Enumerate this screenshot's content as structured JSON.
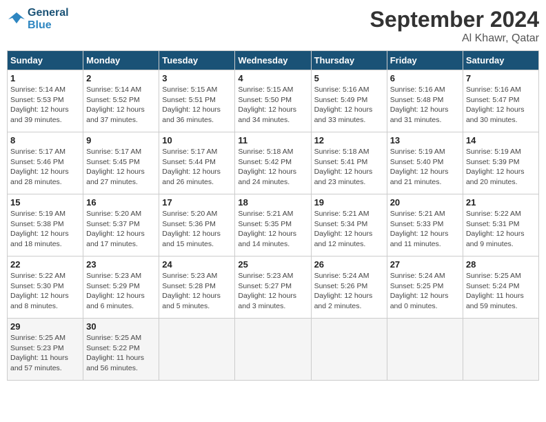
{
  "header": {
    "logo_line1": "General",
    "logo_line2": "Blue",
    "month": "September 2024",
    "location": "Al Khawr, Qatar"
  },
  "days_of_week": [
    "Sunday",
    "Monday",
    "Tuesday",
    "Wednesday",
    "Thursday",
    "Friday",
    "Saturday"
  ],
  "weeks": [
    [
      {
        "day": "1",
        "sunrise": "5:14 AM",
        "sunset": "5:53 PM",
        "daylight": "12 hours and 39 minutes."
      },
      {
        "day": "2",
        "sunrise": "5:14 AM",
        "sunset": "5:52 PM",
        "daylight": "12 hours and 37 minutes."
      },
      {
        "day": "3",
        "sunrise": "5:15 AM",
        "sunset": "5:51 PM",
        "daylight": "12 hours and 36 minutes."
      },
      {
        "day": "4",
        "sunrise": "5:15 AM",
        "sunset": "5:50 PM",
        "daylight": "12 hours and 34 minutes."
      },
      {
        "day": "5",
        "sunrise": "5:16 AM",
        "sunset": "5:49 PM",
        "daylight": "12 hours and 33 minutes."
      },
      {
        "day": "6",
        "sunrise": "5:16 AM",
        "sunset": "5:48 PM",
        "daylight": "12 hours and 31 minutes."
      },
      {
        "day": "7",
        "sunrise": "5:16 AM",
        "sunset": "5:47 PM",
        "daylight": "12 hours and 30 minutes."
      }
    ],
    [
      {
        "day": "8",
        "sunrise": "5:17 AM",
        "sunset": "5:46 PM",
        "daylight": "12 hours and 28 minutes."
      },
      {
        "day": "9",
        "sunrise": "5:17 AM",
        "sunset": "5:45 PM",
        "daylight": "12 hours and 27 minutes."
      },
      {
        "day": "10",
        "sunrise": "5:17 AM",
        "sunset": "5:44 PM",
        "daylight": "12 hours and 26 minutes."
      },
      {
        "day": "11",
        "sunrise": "5:18 AM",
        "sunset": "5:42 PM",
        "daylight": "12 hours and 24 minutes."
      },
      {
        "day": "12",
        "sunrise": "5:18 AM",
        "sunset": "5:41 PM",
        "daylight": "12 hours and 23 minutes."
      },
      {
        "day": "13",
        "sunrise": "5:19 AM",
        "sunset": "5:40 PM",
        "daylight": "12 hours and 21 minutes."
      },
      {
        "day": "14",
        "sunrise": "5:19 AM",
        "sunset": "5:39 PM",
        "daylight": "12 hours and 20 minutes."
      }
    ],
    [
      {
        "day": "15",
        "sunrise": "5:19 AM",
        "sunset": "5:38 PM",
        "daylight": "12 hours and 18 minutes."
      },
      {
        "day": "16",
        "sunrise": "5:20 AM",
        "sunset": "5:37 PM",
        "daylight": "12 hours and 17 minutes."
      },
      {
        "day": "17",
        "sunrise": "5:20 AM",
        "sunset": "5:36 PM",
        "daylight": "12 hours and 15 minutes."
      },
      {
        "day": "18",
        "sunrise": "5:21 AM",
        "sunset": "5:35 PM",
        "daylight": "12 hours and 14 minutes."
      },
      {
        "day": "19",
        "sunrise": "5:21 AM",
        "sunset": "5:34 PM",
        "daylight": "12 hours and 12 minutes."
      },
      {
        "day": "20",
        "sunrise": "5:21 AM",
        "sunset": "5:33 PM",
        "daylight": "12 hours and 11 minutes."
      },
      {
        "day": "21",
        "sunrise": "5:22 AM",
        "sunset": "5:31 PM",
        "daylight": "12 hours and 9 minutes."
      }
    ],
    [
      {
        "day": "22",
        "sunrise": "5:22 AM",
        "sunset": "5:30 PM",
        "daylight": "12 hours and 8 minutes."
      },
      {
        "day": "23",
        "sunrise": "5:23 AM",
        "sunset": "5:29 PM",
        "daylight": "12 hours and 6 minutes."
      },
      {
        "day": "24",
        "sunrise": "5:23 AM",
        "sunset": "5:28 PM",
        "daylight": "12 hours and 5 minutes."
      },
      {
        "day": "25",
        "sunrise": "5:23 AM",
        "sunset": "5:27 PM",
        "daylight": "12 hours and 3 minutes."
      },
      {
        "day": "26",
        "sunrise": "5:24 AM",
        "sunset": "5:26 PM",
        "daylight": "12 hours and 2 minutes."
      },
      {
        "day": "27",
        "sunrise": "5:24 AM",
        "sunset": "5:25 PM",
        "daylight": "12 hours and 0 minutes."
      },
      {
        "day": "28",
        "sunrise": "5:25 AM",
        "sunset": "5:24 PM",
        "daylight": "11 hours and 59 minutes."
      }
    ],
    [
      {
        "day": "29",
        "sunrise": "5:25 AM",
        "sunset": "5:23 PM",
        "daylight": "11 hours and 57 minutes."
      },
      {
        "day": "30",
        "sunrise": "5:25 AM",
        "sunset": "5:22 PM",
        "daylight": "11 hours and 56 minutes."
      },
      null,
      null,
      null,
      null,
      null
    ]
  ]
}
